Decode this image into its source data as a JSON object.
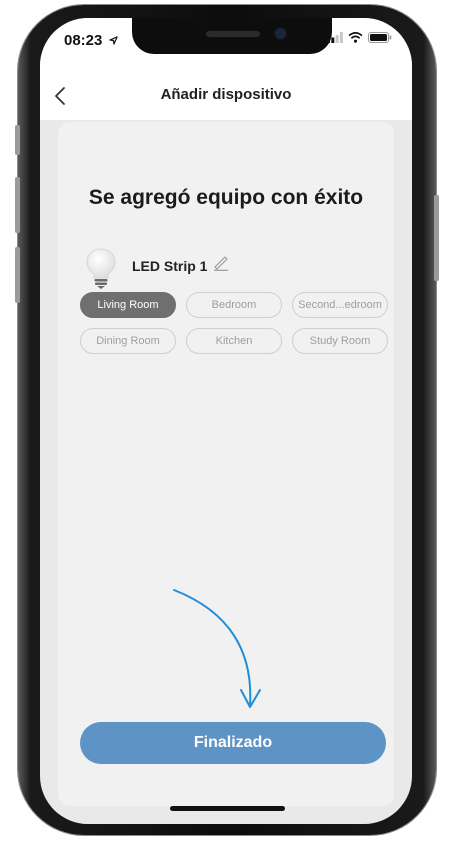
{
  "status": {
    "time": "08:23"
  },
  "nav": {
    "title": "Añadir dispositivo"
  },
  "main": {
    "headline": "Se agregó equipo con éxito",
    "device_name": "LED Strip 1",
    "rooms": [
      {
        "label": "Living Room",
        "selected": true
      },
      {
        "label": "Bedroom",
        "selected": false
      },
      {
        "label": "Second...edroom",
        "selected": false
      },
      {
        "label": "Dining Room",
        "selected": false
      },
      {
        "label": "Kitchen",
        "selected": false
      },
      {
        "label": "Study Room",
        "selected": false
      }
    ],
    "done_label": "Finalizado"
  },
  "colors": {
    "accent": "#5e93c6",
    "selected_chip": "#6f6f6f",
    "annotation_arrow": "#1f8fd6"
  },
  "icons": {
    "back": "chevron-left-icon",
    "bulb": "light-bulb-icon",
    "edit": "pencil-icon",
    "location": "location-arrow-icon",
    "signal": "signal-icon",
    "wifi": "wifi-icon",
    "battery": "battery-icon"
  }
}
